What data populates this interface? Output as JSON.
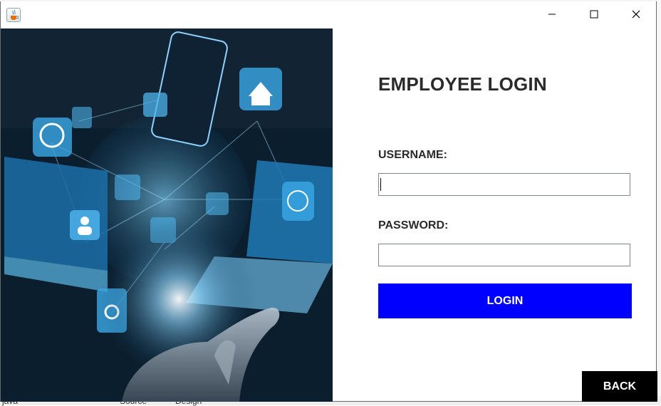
{
  "window": {
    "icon": "java-cup-icon"
  },
  "ide_background": {
    "file_tab": "java",
    "source_tab": "Source",
    "design_tab": "Design"
  },
  "hero_image": {
    "description_icon": "tech-network-hand-image"
  },
  "form": {
    "title": "EMPLOYEE LOGIN",
    "username_label": "USERNAME:",
    "username_value": "",
    "password_label": "PASSWORD:",
    "password_value": "",
    "login_button": "LOGIN",
    "back_button": "BACK",
    "login_color": "#0000ff",
    "back_color": "#000000"
  }
}
